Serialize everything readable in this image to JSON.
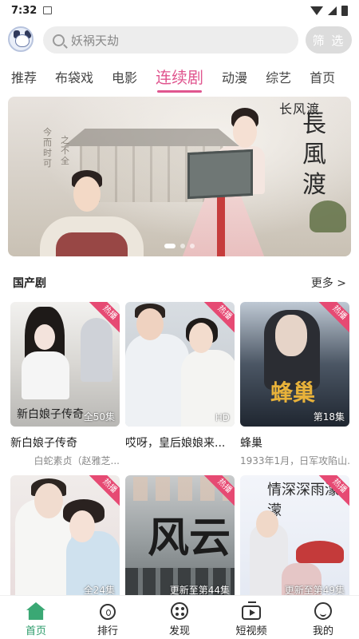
{
  "status_bar": {
    "time": "7:32"
  },
  "search": {
    "placeholder": "妖祸天劫",
    "filter_label": "筛 选"
  },
  "tabs": [
    {
      "label": "推荐"
    },
    {
      "label": "布袋戏"
    },
    {
      "label": "电影"
    },
    {
      "label": "连续剧",
      "active": true
    },
    {
      "label": "动漫"
    },
    {
      "label": "综艺"
    },
    {
      "label": "首页"
    }
  ],
  "banner": {
    "title": "長風渡",
    "top_mark": "长风渡",
    "caption_1": "今而时可",
    "caption_2": "之不全",
    "page_index": 1,
    "page_count": 3
  },
  "section": {
    "title": "国产剧",
    "more": "更多 >"
  },
  "cards": [
    {
      "title": "新白娘子传奇",
      "subtitle": "白蛇素贞（赵雅芝...",
      "badge": "热播",
      "episode": "全50集",
      "poster_text": "新白娘子传奇"
    },
    {
      "title": "哎呀，皇后娘娘来...",
      "subtitle": "",
      "badge": "热播",
      "episode": "HD",
      "poster_text": ""
    },
    {
      "title": "蜂巢",
      "subtitle": "1933年1月，日军攻陷山...",
      "badge": "热播",
      "episode": "第18集",
      "poster_text": "蜂巢"
    },
    {
      "title": "",
      "subtitle": "",
      "badge": "热播",
      "episode": "全24集",
      "poster_text": ""
    },
    {
      "title": "",
      "subtitle": "",
      "badge": "热播",
      "episode": "更新至第44集",
      "poster_text": "风云"
    },
    {
      "title": "",
      "subtitle": "",
      "badge": "热播",
      "episode": "更新至第49集",
      "poster_text": "情深深雨濛濛"
    }
  ],
  "bottom_nav": [
    {
      "label": "首页",
      "icon": "home-icon",
      "active": true
    },
    {
      "label": "排行",
      "icon": "rank-icon"
    },
    {
      "label": "发现",
      "icon": "discover-icon"
    },
    {
      "label": "短视频",
      "icon": "short-video-icon"
    },
    {
      "label": "我的",
      "icon": "profile-icon"
    }
  ],
  "colors": {
    "accent": "#e0568f",
    "nav_active": "#2b9b6a",
    "badge": "#e64a73"
  }
}
